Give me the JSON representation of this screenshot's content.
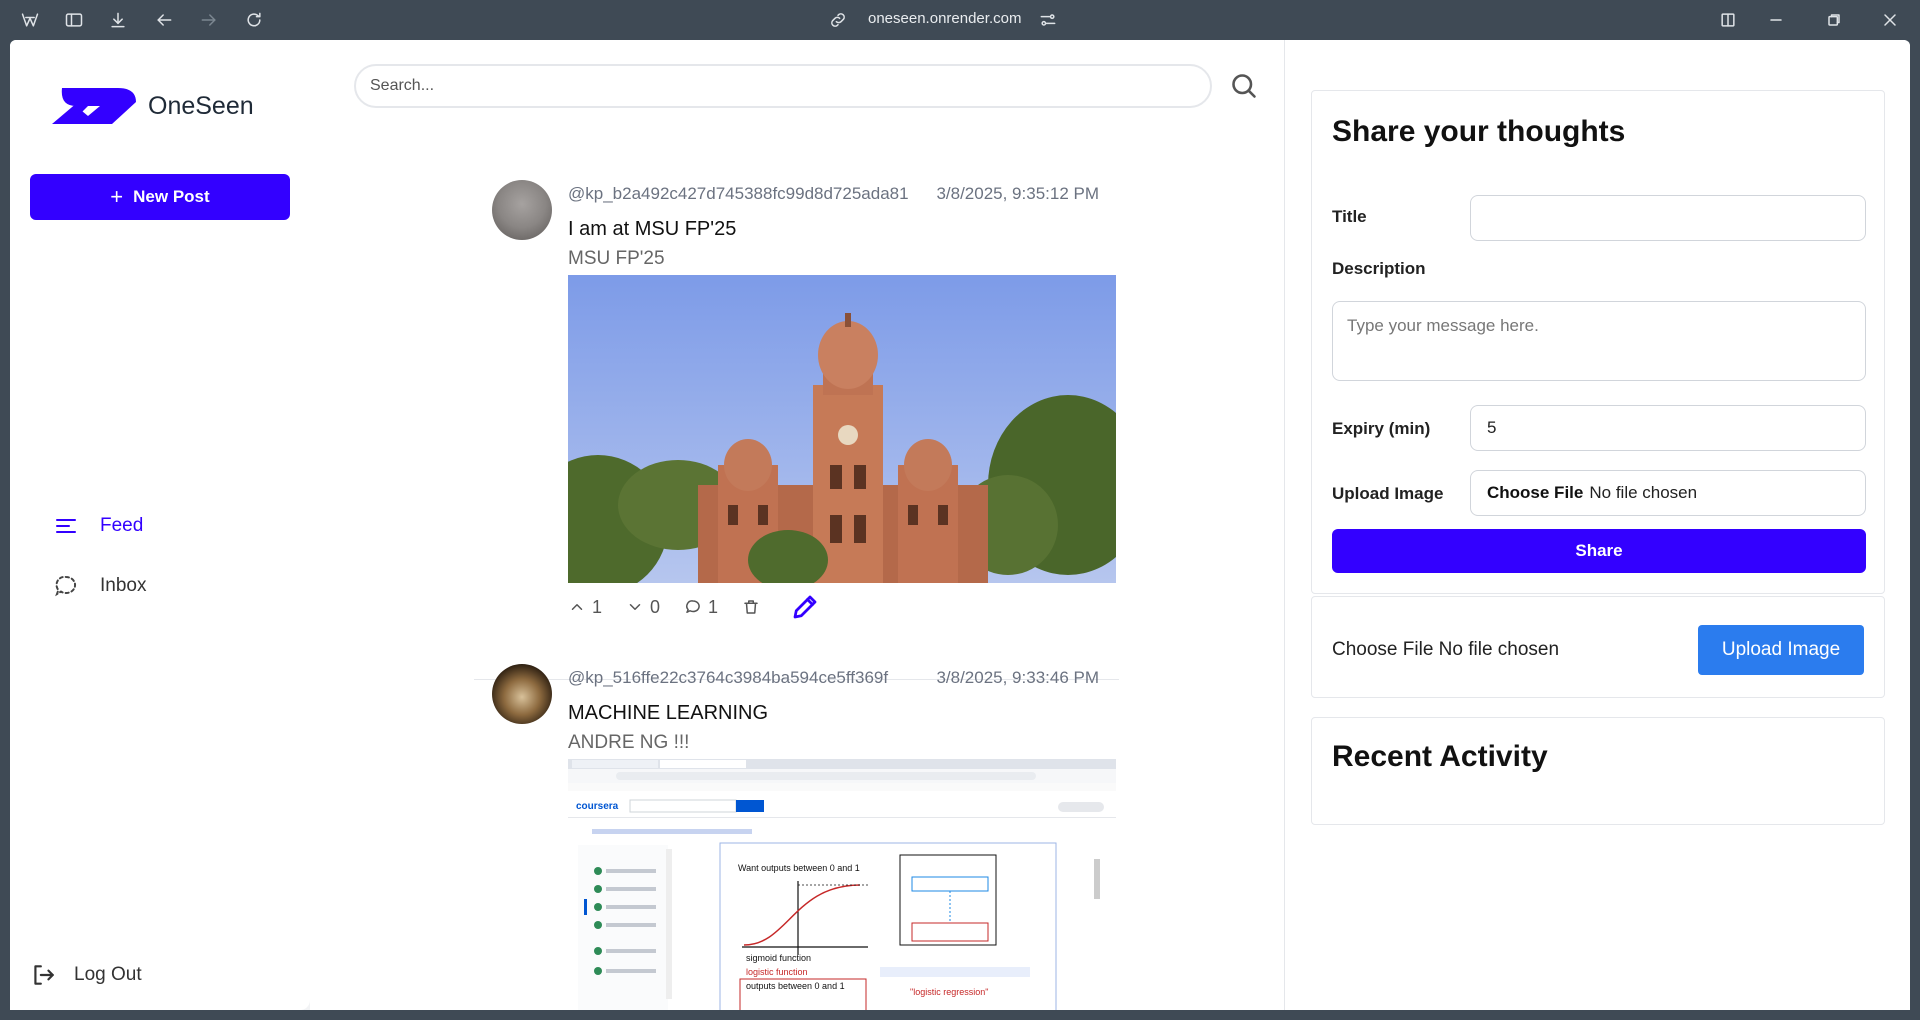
{
  "browser": {
    "url": "oneseen.onrender.com"
  },
  "brand": {
    "name": "OneSeen",
    "color": "#3300ff"
  },
  "sidebar": {
    "new_post_label": "New Post",
    "nav": [
      {
        "label": "Feed",
        "icon": "feed-lines-icon",
        "active": true
      },
      {
        "label": "Inbox",
        "icon": "chat-bubble-icon",
        "active": false
      }
    ],
    "logout_label": "Log Out"
  },
  "search": {
    "placeholder": "Search..."
  },
  "posts": [
    {
      "username": "@kp_b2a492c427d745388fc99d8d725ada81",
      "timestamp": "3/8/2025, 9:35:12 PM",
      "title": "I am at MSU FP'25",
      "description": "MSU FP'25",
      "image": "photo of ornate red sandstone palace with domes and clock tower under blue sky",
      "upvotes": "1",
      "downvotes": "0",
      "comments": "1"
    },
    {
      "username": "@kp_516ffe22c3764c3984ba594ce5ff369f",
      "timestamp": "3/8/2025, 9:33:46 PM",
      "title": "MACHINE LEARNING",
      "description": "ANDRE NG !!!",
      "image": "screenshot of coursera logistic regression lecture",
      "screenshot_text": {
        "coursera": "coursera",
        "want": "Want outputs between 0 and 1",
        "sigmoid": "sigmoid function",
        "logistic": "logistic function",
        "outputs": "outputs between 0 and 1",
        "regression": "\"logistic regression\""
      }
    }
  ],
  "share_form": {
    "heading": "Share your thoughts",
    "title_label": "Title",
    "title_value": "",
    "description_label": "Description",
    "description_placeholder": "Type your message here.",
    "expiry_label": "Expiry (min)",
    "expiry_value": "5",
    "upload_label": "Upload Image",
    "choose_file": "Choose File",
    "no_file": "No file chosen",
    "share_label": "Share"
  },
  "upload_card": {
    "file_text": "Choose File No file chosen",
    "button_label": "Upload Image",
    "button_color": "#2b7cee"
  },
  "recent": {
    "heading": "Recent Activity"
  }
}
